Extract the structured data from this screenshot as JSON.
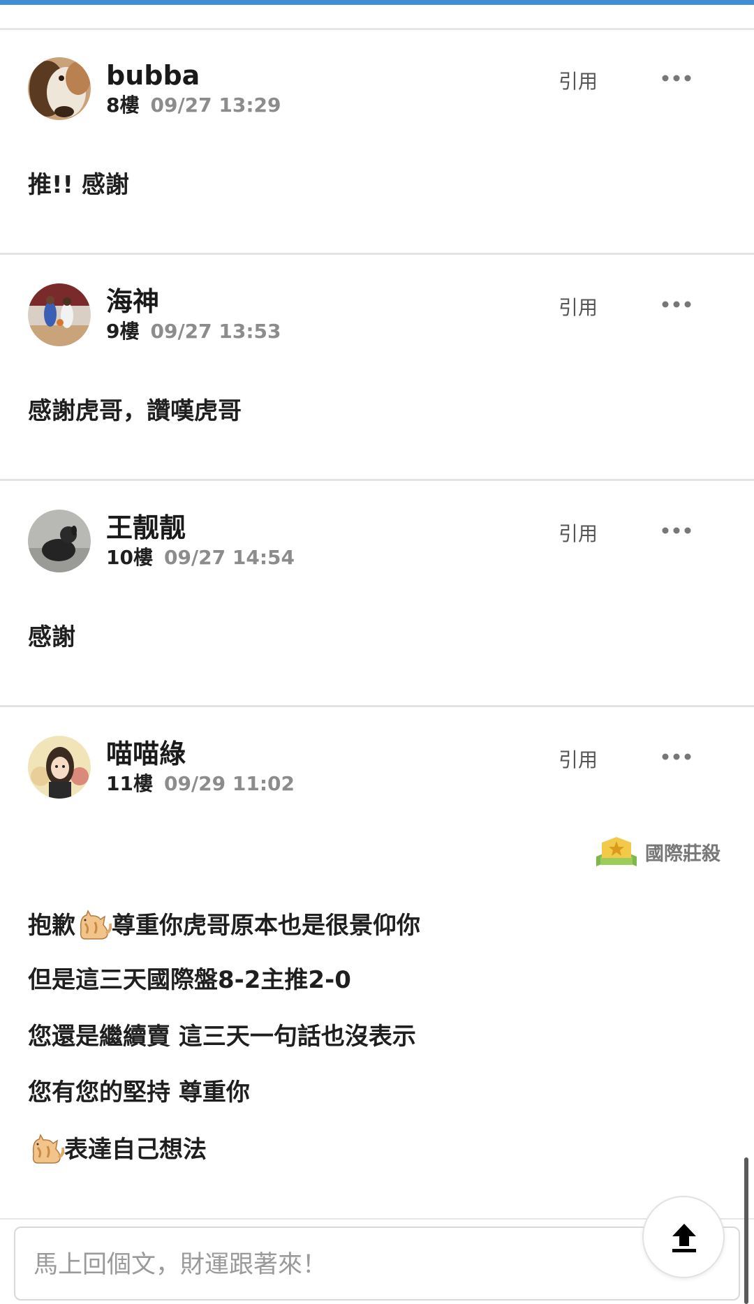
{
  "colors": {
    "accent": "#3d8fd6",
    "username": "#1a1a1a",
    "datetime": "#8c8c8c",
    "action": "#555555",
    "divider": "#e3e3e3",
    "placeholder": "#9a9a9a"
  },
  "posts": [
    {
      "username": "bubba",
      "floor": "8樓",
      "datetime": "09/27 13:29",
      "quote_label": "引用",
      "more_icon": "more-icon",
      "body": "推!! 感謝"
    },
    {
      "username": "海神",
      "floor": "9樓",
      "datetime": "09/27 13:53",
      "quote_label": "引用",
      "more_icon": "more-icon",
      "body": "感謝虎哥，讚嘆虎哥"
    },
    {
      "username": "王靓靓",
      "floor": "10樓",
      "datetime": "09/27 14:54",
      "quote_label": "引用",
      "more_icon": "more-icon",
      "body": "感謝"
    },
    {
      "username": "喵喵綠",
      "floor": "11樓",
      "datetime": "09/29 11:02",
      "quote_label": "引用",
      "more_icon": "more-icon",
      "badge": {
        "icon": "star-badge-icon",
        "label": "國際莊殺"
      },
      "body_lines": [
        {
          "emoji": "cat-icon",
          "before": "抱歉",
          "after": "尊重你虎哥原本也是很景仰你"
        },
        {
          "text": "但是這三天國際盤8-2主推2-0"
        },
        {
          "text": "您還是繼續賣 這三天一句話也沒表示"
        },
        {
          "text": "您有您的堅持 尊重你"
        },
        {
          "emoji": "cat-icon",
          "before": "",
          "after": "表達自己想法"
        }
      ]
    }
  ],
  "reply": {
    "placeholder": "馬上回個文，財運跟著來！",
    "value": ""
  },
  "scroll_top_icon": "upload-arrow-icon"
}
